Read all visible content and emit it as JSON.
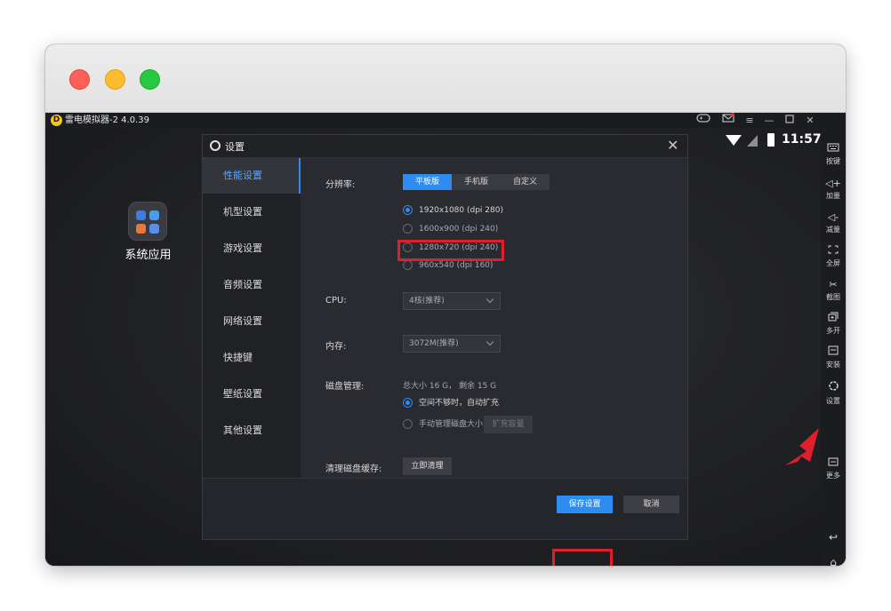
{
  "emulator": {
    "title": "雷电模拟器-2 4.0.39",
    "logo_letter": "D",
    "time": "11:57"
  },
  "desktop": {
    "app_label": "系统应用"
  },
  "dialog": {
    "title": "设置",
    "nav": [
      "性能设置",
      "机型设置",
      "游戏设置",
      "音频设置",
      "网络设置",
      "快捷键",
      "壁纸设置",
      "其他设置"
    ],
    "active_nav_index": 0,
    "resolution": {
      "label": "分辨率:",
      "tabs": [
        "平板版",
        "手机版",
        "自定义"
      ],
      "active_tab": "平板版",
      "options": [
        "1920x1080 (dpi 280)",
        "1600x900 (dpi 240)",
        "1280x720 (dpi 240)",
        "960x540 (dpi 160)"
      ],
      "selected_option": "1920x1080 (dpi 280)"
    },
    "cpu": {
      "label": "CPU:",
      "value": "4核(推荐)"
    },
    "memory": {
      "label": "内存:",
      "value": "3072M(推荐)"
    },
    "disk": {
      "label": "磁盘管理:",
      "summary": "总大小 16 G， 剩余 15 G",
      "options": [
        "空间不够时，自动扩充",
        "手动管理磁盘大小"
      ],
      "selected_option": "空间不够时，自动扩充",
      "expand_button": "扩充容量"
    },
    "cache": {
      "label": "清理磁盘缓存:",
      "button": "立即清理"
    },
    "footer": {
      "save_button": "保存设置",
      "cancel_button": "取消"
    }
  },
  "sidebar": {
    "items": [
      {
        "label": "按键",
        "icon": "keyboard-icon"
      },
      {
        "label": "加量",
        "icon": "volume-up-icon"
      },
      {
        "label": "减量",
        "icon": "volume-down-icon"
      },
      {
        "label": "全屏",
        "icon": "fullscreen-icon"
      },
      {
        "label": "截图",
        "icon": "scissors-icon"
      },
      {
        "label": "多开",
        "icon": "multi-open-icon"
      },
      {
        "label": "安装",
        "icon": "apk-install-icon"
      },
      {
        "label": "设置",
        "icon": "gear-icon"
      },
      {
        "label": "更多",
        "icon": "more-icon"
      }
    ]
  },
  "colors": {
    "accent": "#2d8cf0",
    "highlight": "#e01f2b",
    "background": "#1c1d21"
  }
}
